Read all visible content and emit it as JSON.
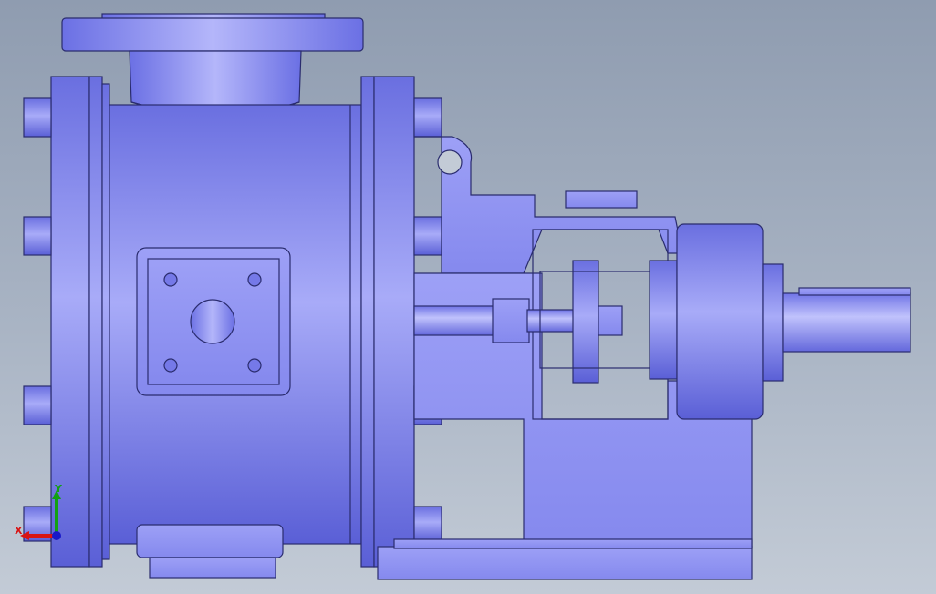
{
  "viewport": {
    "background_top": "#8f9cb0",
    "background_bottom": "#c3cbd6",
    "model_color": "#8a8ff2",
    "edge_color": "#2a2c6e"
  },
  "triad": {
    "x_label": "X",
    "y_label": "Y",
    "x_color": "#d81414",
    "y_color": "#12a012",
    "z_color": "#1818c8"
  },
  "model": {
    "name": "pump-assembly",
    "parts": [
      "inlet-flange",
      "pump-casing",
      "front-cover",
      "rear-flange",
      "bolt-heads",
      "bearing-bracket",
      "coupling",
      "motor-adapter",
      "shaft",
      "base-plate",
      "drain-port",
      "inspection-plate"
    ]
  }
}
